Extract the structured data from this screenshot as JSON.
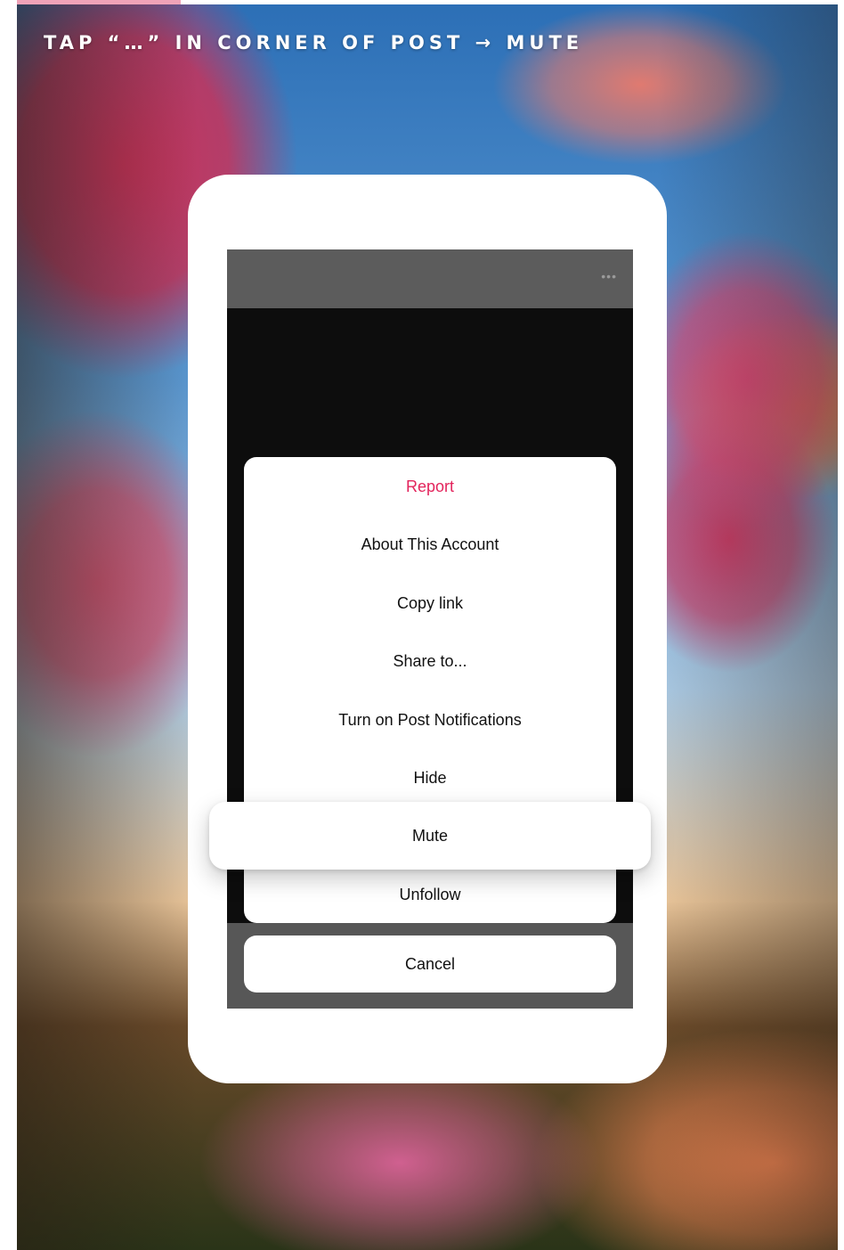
{
  "caption": "TAP “…” IN CORNER OF POST → MUTE",
  "screen": {
    "more_icon": "more-dots-icon",
    "more_glyph": "•••"
  },
  "menu": {
    "report": "Report",
    "about": "About This Account",
    "copy_link": "Copy link",
    "share": "Share to...",
    "notifications": "Turn on Post Notifications",
    "hide": "Hide",
    "mute": "Mute",
    "unfollow": "Unfollow",
    "cancel": "Cancel"
  },
  "colors": {
    "accent": "#f0a3b8",
    "danger": "#e3245c"
  }
}
